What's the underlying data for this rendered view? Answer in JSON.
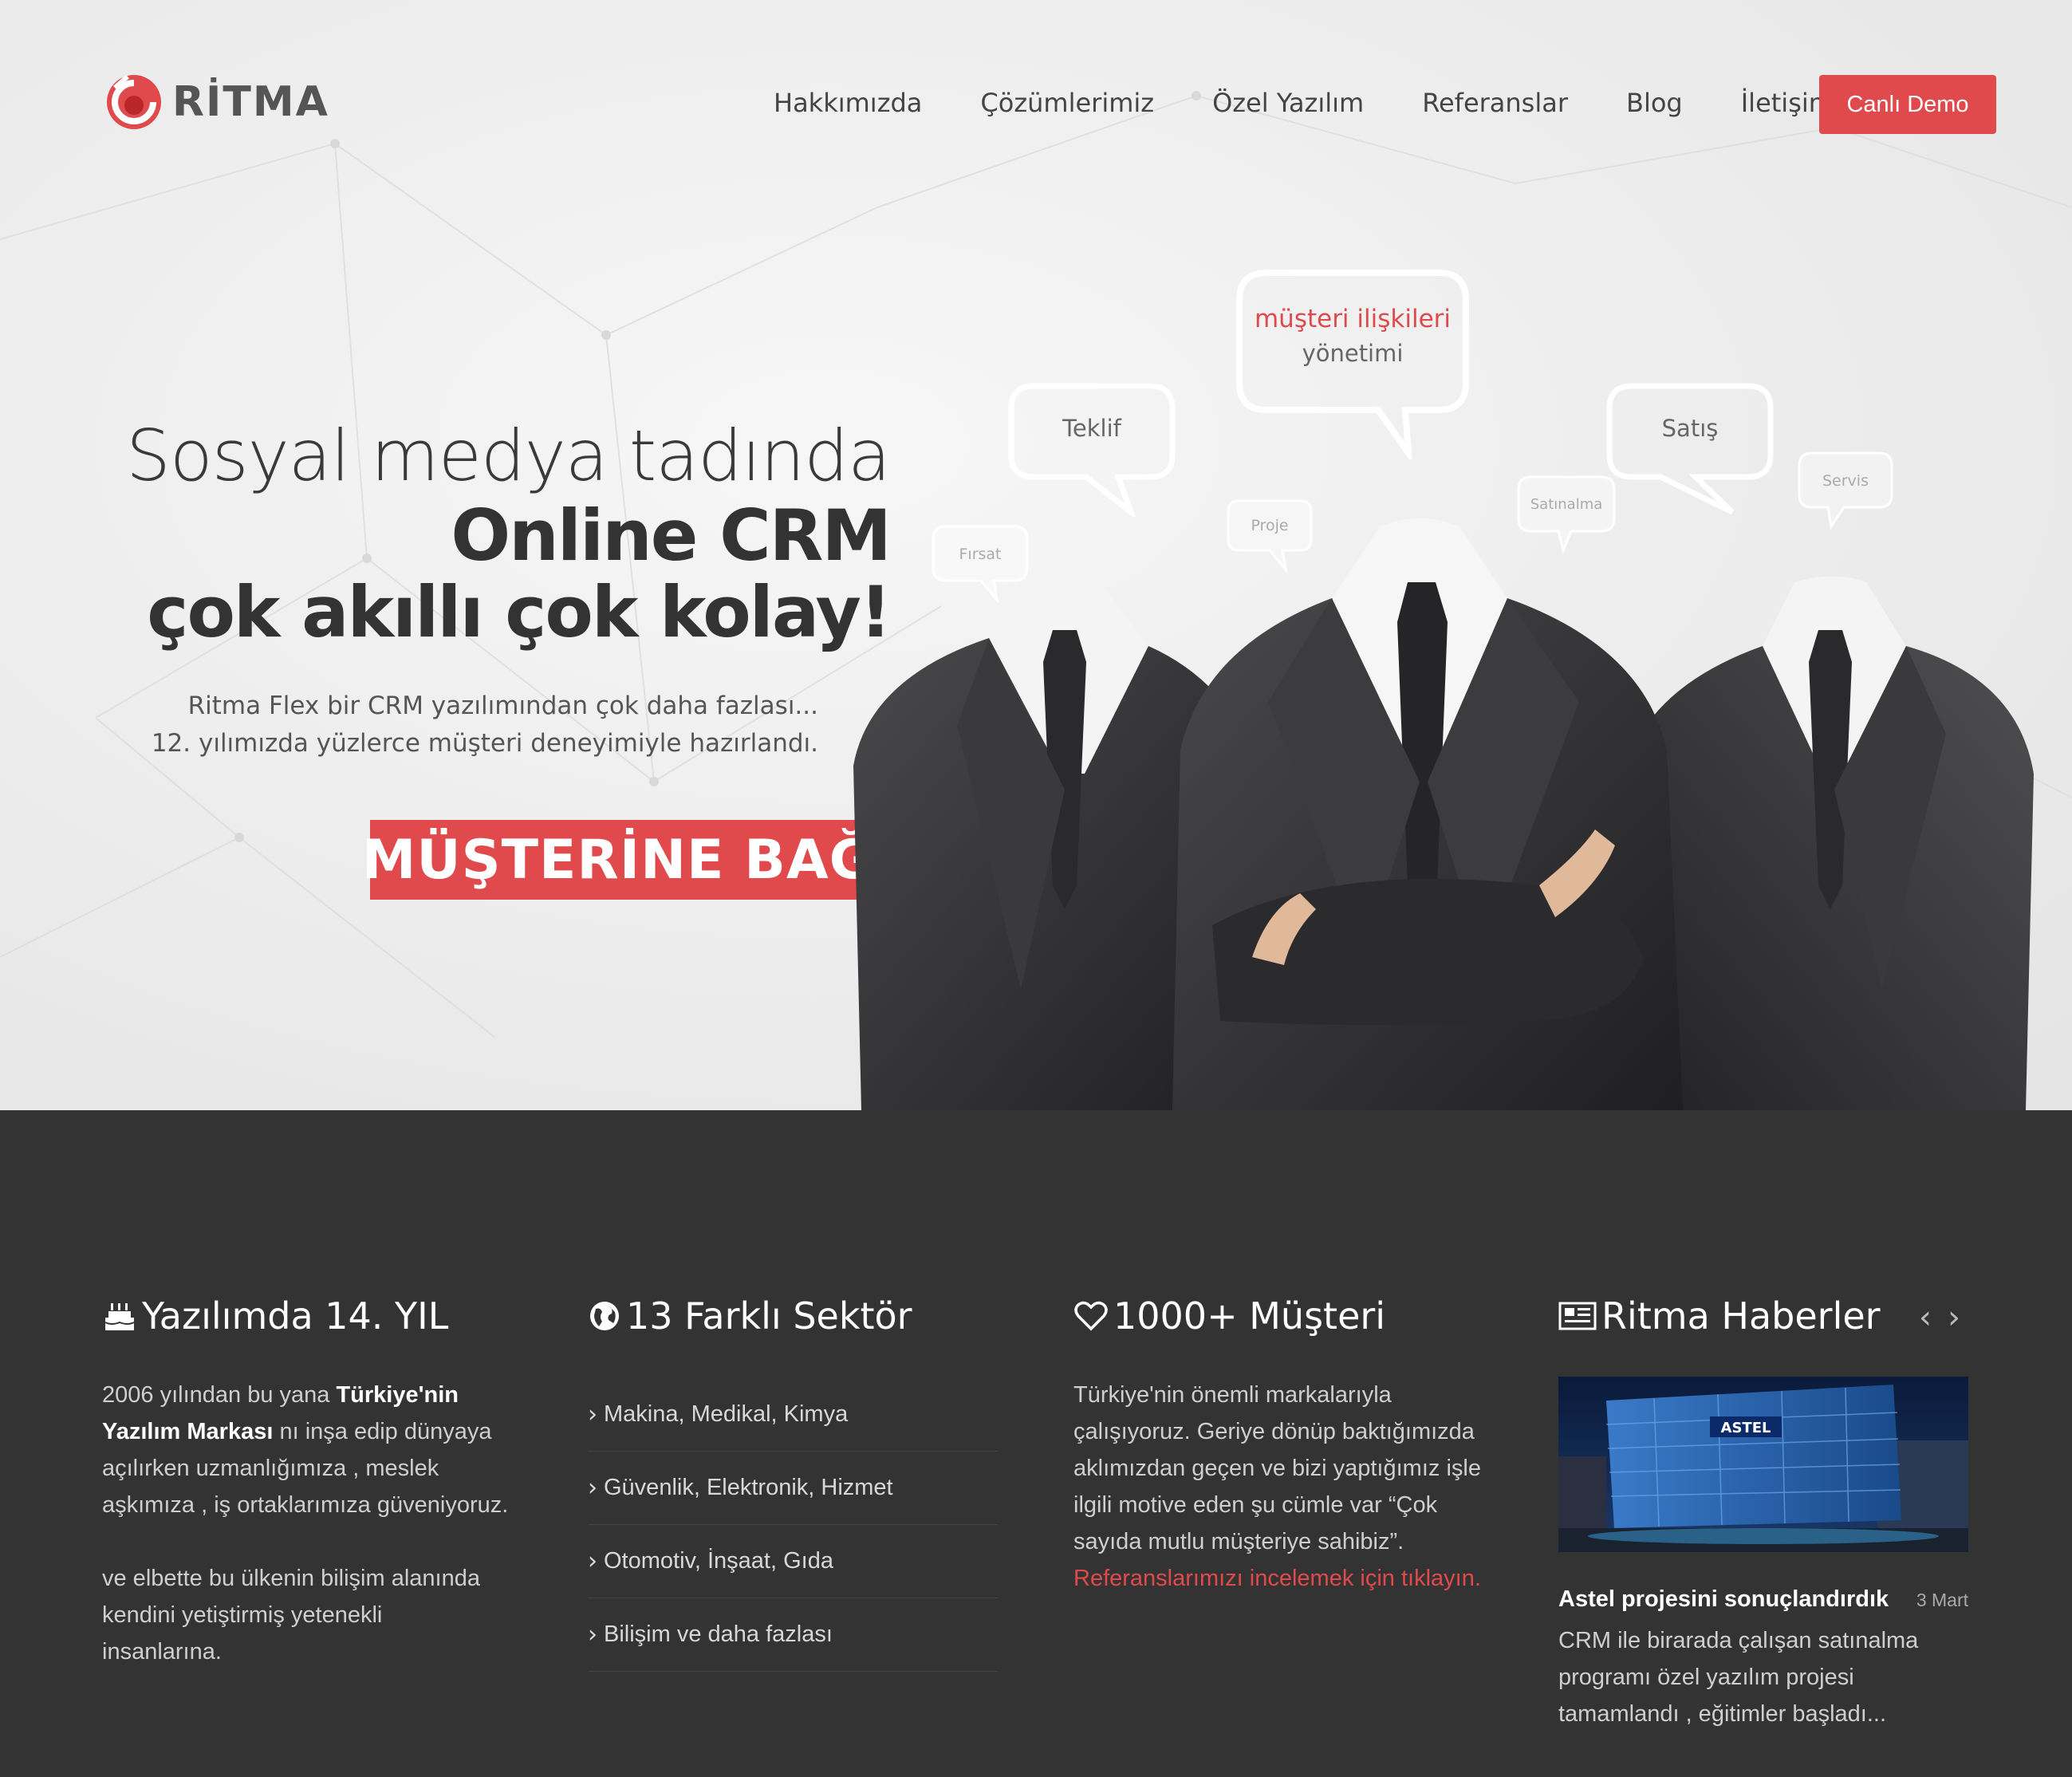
{
  "brand": {
    "name": "RİTMA",
    "accent": "#e14a4d",
    "dark_bg": "#333334"
  },
  "nav": {
    "items": [
      "Hakkımızda",
      "Çözümlerimiz",
      "Özel Yazılım",
      "Referanslar",
      "Blog",
      "İletişim"
    ],
    "demo_label": "Canlı Demo"
  },
  "hero": {
    "line1": "Sosyal medya tadında",
    "line2": "Online CRM",
    "line3": "çok akıllı çok kolay!",
    "sub1": "Ritma Flex bir CRM yazılımından çok daha fazlası...",
    "sub2": "12. yılımızda yüzlerce müşteri deneyimiyle hazırlandı.",
    "cta": "MÜŞTERİNE BAĞLAN",
    "bubbles": {
      "main_red": "müşteri ilişkileri",
      "main_gray": "yönetimi",
      "teklif": "Teklif",
      "satis": "Satış",
      "firsat": "Fırsat",
      "proje": "Proje",
      "satinalma": "Satınalma",
      "servis": "Servis"
    }
  },
  "features": {
    "years": {
      "title": "Yazılımda 14. YIL",
      "p1_a": "2006 yılından bu yana ",
      "p1_b": "Türkiye'nin",
      "p1_c": "Yazılım Markası",
      "p1_d": " nı inşa edip dünyaya",
      "p1_e": "açılırken uzmanlığımıza , meslek",
      "p1_f": "aşkımıza , iş ortaklarımıza güveniyoruz.",
      "p2_a": "ve elbette bu ülkenin bilişim alanında",
      "p2_b": "kendini yetiştirmiş yetenekli",
      "p2_c": "insanlarına."
    },
    "sectors": {
      "title": "13 Farklı Sektör",
      "items": [
        "Makina, Medikal, Kimya",
        "Güvenlik, Elektronik, Hizmet",
        "Otomotiv, İnşaat, Gıda",
        "Bilişim ve daha fazlası"
      ]
    },
    "customers": {
      "title": "1000+ Müşteri",
      "l1": "Türkiye'nin önemli markalarıyla",
      "l2": "çalışıyoruz. Geriye dönüp baktığımızda",
      "l3": "aklımızdan geçen ve bizi yaptığımız işle",
      "l4": "ilgili motive eden şu cümle var “Çok",
      "l5": "sayıda mutlu müşteriye sahibiz”.",
      "link": "Referanslarımızı incelemek için tıklayın."
    },
    "news": {
      "title": "Ritma Haberler",
      "prev": "‹",
      "next": "›",
      "image_sign": "ASTEL",
      "item_title": "Astel projesini sonuçlandırdık",
      "item_date": "3 Mart",
      "t1": "CRM ile birarada çalışan satınalma",
      "t2": "programı özel yazılım projesi",
      "t3": "tamamlandı , eğitimler başladı..."
    }
  }
}
